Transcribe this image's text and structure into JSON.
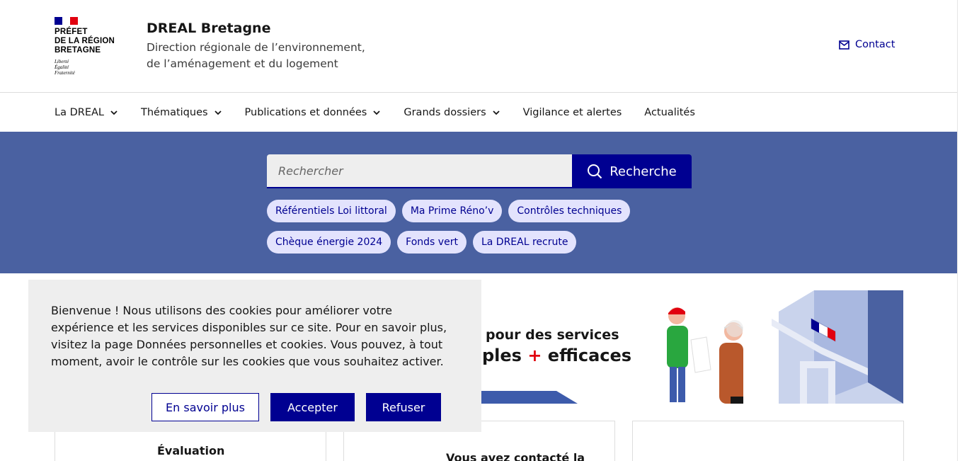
{
  "header": {
    "logo_lines": [
      "PRÉFET",
      "DE LA RÉGION",
      "BRETAGNE"
    ],
    "devise": [
      "Liberté",
      "Égalité",
      "Fraternité"
    ],
    "site_title": "DREAL Bretagne",
    "site_desc_line1": "Direction régionale de l’environnement,",
    "site_desc_line2": "de l’aménagement et du logement",
    "contact_label": "Contact",
    "flag_colors": [
      "#000091",
      "#ffffff",
      "#e1000f"
    ]
  },
  "nav": {
    "items": [
      {
        "label": "La DREAL",
        "has_menu": true
      },
      {
        "label": "Thématiques",
        "has_menu": true
      },
      {
        "label": "Publications et données",
        "has_menu": true
      },
      {
        "label": "Grands dossiers",
        "has_menu": true
      },
      {
        "label": "Vigilance et alertes",
        "has_menu": false
      },
      {
        "label": "Actualités",
        "has_menu": false
      }
    ]
  },
  "search": {
    "placeholder": "Rechercher",
    "button_label": "Recherche",
    "tags": [
      "Référentiels Loi littoral",
      "Ma Prime Réno’v",
      "Contrôles techniques",
      "Chèque énergie 2024",
      "Fonds vert",
      "La DREAL recrute"
    ]
  },
  "banner": {
    "line1": "pour des services",
    "line2_pre": "ples ",
    "line2_plus": "+",
    "line2_post": " efficaces"
  },
  "cards": {
    "card1_title": "Évaluation",
    "card2_title": "Vous avez contacté la"
  },
  "cookie": {
    "text": "Bienvenue ! Nous utilisons des cookies pour améliorer votre expérience et les services disponibles sur ce site. Pour en savoir plus, visitez la page Données personnelles et cookies. Vous pouvez, à tout moment, avoir le contrôle sur les cookies que vous souhaitez activer.",
    "btn_more": "En savoir plus",
    "btn_accept": "Accepter",
    "btn_refuse": "Refuser"
  },
  "colors": {
    "primary": "#000091",
    "band": "#4a61a1",
    "tag_bg": "#e3e3fd",
    "cookie_bg": "#eeeeee"
  }
}
